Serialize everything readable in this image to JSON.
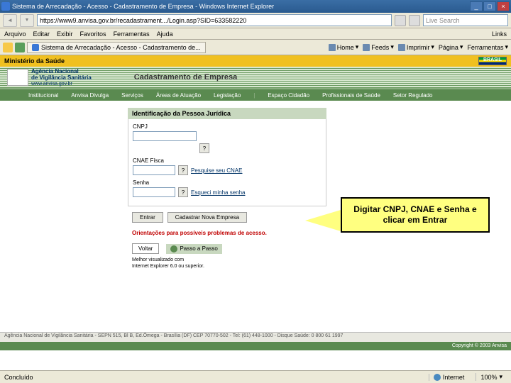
{
  "titlebar": {
    "title": "Sistema de Arrecadação - Acesso - Cadastramento de Empresa - Windows Internet Explorer"
  },
  "navbar": {
    "url": "https://www9.anvisa.gov.br/recadastrament.../Login.asp?SID=633582220",
    "search_placeholder": "Live Search"
  },
  "menubar": {
    "items": [
      "Arquivo",
      "Editar",
      "Exibir",
      "Favoritos",
      "Ferramentas",
      "Ajuda"
    ],
    "links": "Links"
  },
  "tabbar": {
    "tab_title": "Sistema de Arrecadação - Acesso - Cadastramento de...",
    "toolbar": {
      "home": "Home",
      "feeds": "Feeds",
      "print": "Imprimir",
      "page": "Página",
      "tools": "Ferramentas"
    }
  },
  "header": {
    "ministry": "Ministério da Saúde",
    "brasil": "BRASIL",
    "agency_line1": "Agência Nacional",
    "agency_line2": "de Vigilância Sanitária",
    "agency_url": "www.anvisa.gov.br",
    "page_title": "Cadastramento de Empresa"
  },
  "nav": {
    "items": [
      "Institucional",
      "Anvisa Divulga",
      "Serviços",
      "Áreas de Atuação",
      "Legislação",
      "Espaço Cidadão",
      "Profissionais de Saúde",
      "Setor Regulado"
    ]
  },
  "form": {
    "section_title": "Identificação da Pessoa Jurídica",
    "cnpj_label": "CNPJ",
    "cnae_label": "CNAE Físca",
    "cnae_link": "Pesquise seu CNAE",
    "senha_label": "Senha",
    "senha_link": "Esqueci minha senha",
    "help": "?",
    "entrar": "Entrar",
    "cadastrar": "Cadastrar Nova Empresa"
  },
  "warning": "Orientações para possíveis problemas de acesso.",
  "passo": {
    "voltar": "Voltar",
    "passo": "Passo a Passo",
    "viz1": "Melhor visualizado com",
    "viz2": "Internet Explorer 6.0 ou superior."
  },
  "callout": {
    "text": "Digitar CNPJ, CNAE e Senha e clicar em Entrar"
  },
  "footer": {
    "address": "Agência Nacional de Vigilância Sanitária - SEPN 515, Bl B, Ed.Ômega - Brasília (DF) CEP 70770-502 - Tel: (61) 448-1000 - Disque Saúde: 0 800 61 1997",
    "copyright": "Copyright © 2003 Anvisa"
  },
  "statusbar": {
    "status": "Concluído",
    "zone": "Internet",
    "zoom": "100%"
  }
}
